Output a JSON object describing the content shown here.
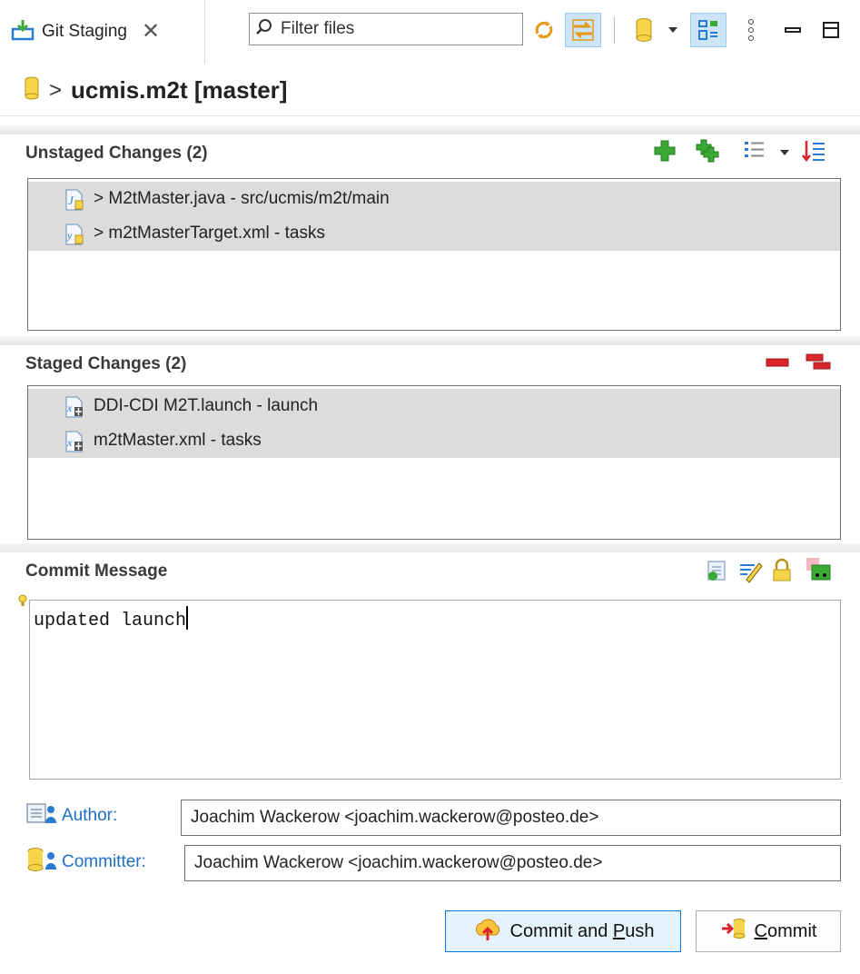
{
  "tab": {
    "title": "Git Staging",
    "close_glyph": "✕"
  },
  "filter": {
    "placeholder": "Filter files"
  },
  "repository": {
    "prefix": ">",
    "name": "ucmis.m2t [master]"
  },
  "unstaged": {
    "header": "Unstaged Changes (2)",
    "items": [
      {
        "label": "> M2tMaster.java - src/ucmis/m2t/main",
        "icon": "java-file-icon"
      },
      {
        "label": "> m2tMasterTarget.xml - tasks",
        "icon": "xml-file-icon"
      }
    ]
  },
  "staged": {
    "header": "Staged Changes (2)",
    "items": [
      {
        "label": "DDI-CDI M2T.launch - launch",
        "icon": "launch-file-icon"
      },
      {
        "label": "m2tMaster.xml - tasks",
        "icon": "xml-file-icon"
      }
    ]
  },
  "commit_message": {
    "header": "Commit Message",
    "text": "updated launch"
  },
  "author": {
    "label": "Author:",
    "value": "Joachim Wackerow <joachim.wackerow@posteo.de>"
  },
  "committer": {
    "label": "Committer:",
    "value": "Joachim Wackerow <joachim.wackerow@posteo.de>"
  },
  "buttons": {
    "commit_push_pre": "Commit and ",
    "commit_push_mnemonic": "P",
    "commit_push_post": "ush",
    "commit_mnemonic": "C",
    "commit_post": "ommit"
  },
  "colors": {
    "accent_blue": "#1f6fc4",
    "add_green": "#3aaa35",
    "remove_red": "#d9262c",
    "selection_gray": "#dcdcdc"
  }
}
